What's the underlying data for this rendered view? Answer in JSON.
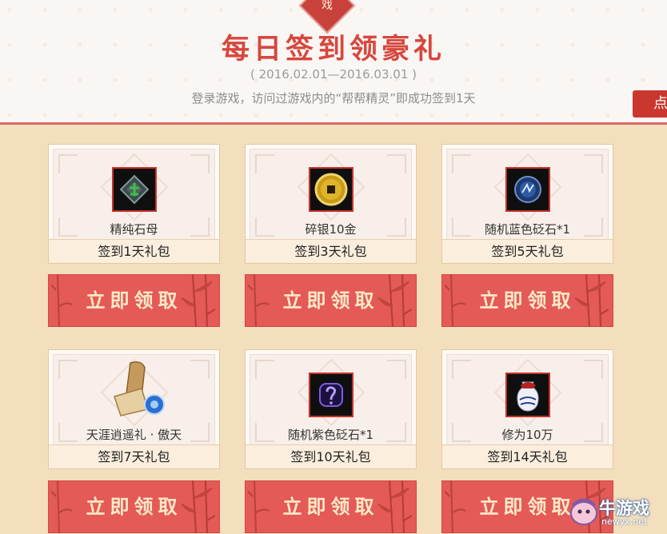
{
  "header": {
    "badge_char": "戏",
    "title": "每日签到领豪礼",
    "dates": "( 2016.02.01—2016.03.01 )",
    "rule": "登录游戏，访问过游戏内的“帮帮精灵”即成功签到1天",
    "side_button": "点"
  },
  "rewards": [
    {
      "item": "精纯石母",
      "pack": "签到1天礼包",
      "button": "立即领取",
      "icon": "green-stone-icon"
    },
    {
      "item": "碎银10金",
      "pack": "签到3天礼包",
      "button": "立即领取",
      "icon": "gold-coin-icon"
    },
    {
      "item": "随机蓝色砭石*1",
      "pack": "签到5天礼包",
      "button": "立即领取",
      "icon": "blue-stone-icon"
    },
    {
      "item": "天涯逍遥礼 · 傲天",
      "pack": "签到7天礼包",
      "button": "立即领取",
      "icon": "scroll-gift-icon"
    },
    {
      "item": "随机紫色砭石*1",
      "pack": "签到10天礼包",
      "button": "立即领取",
      "icon": "purple-stone-icon"
    },
    {
      "item": "修为10万",
      "pack": "签到14天礼包",
      "button": "立即领取",
      "icon": "porcelain-jar-icon"
    }
  ],
  "watermark": {
    "name": "牛游戏",
    "url": "newyx.net"
  }
}
